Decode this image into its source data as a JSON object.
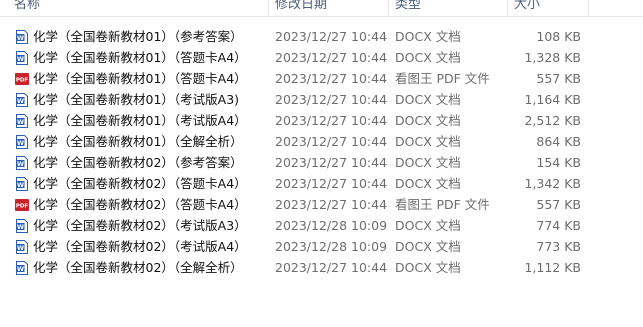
{
  "headers": {
    "name": "名称",
    "date": "修改日期",
    "type": "类型",
    "size": "大小"
  },
  "icons": {
    "docx": "word-doc-icon",
    "pdf": "pdf-doc-icon"
  },
  "colors": {
    "word_blue": "#2b5fb4",
    "pdf_red": "#c8222a",
    "header_text": "#4c607a"
  },
  "files": [
    {
      "name": "化学（全国卷新教材01）（参考答案）",
      "date": "2023/12/27 10:44",
      "type": "DOCX 文档",
      "size": "108 KB",
      "icon": "docx"
    },
    {
      "name": "化学（全国卷新教材01）（答题卡A4）",
      "date": "2023/12/27 10:44",
      "type": "DOCX 文档",
      "size": "1,328 KB",
      "icon": "docx"
    },
    {
      "name": "化学（全国卷新教材01）（答题卡A4）",
      "date": "2023/12/27 10:44",
      "type": "看图王 PDF 文件",
      "size": "557 KB",
      "icon": "pdf"
    },
    {
      "name": "化学（全国卷新教材01）（考试版A3)",
      "date": "2023/12/27 10:44",
      "type": "DOCX 文档",
      "size": "1,164 KB",
      "icon": "docx"
    },
    {
      "name": "化学（全国卷新教材01）（考试版A4）",
      "date": "2023/12/27 10:44",
      "type": "DOCX 文档",
      "size": "2,512 KB",
      "icon": "docx"
    },
    {
      "name": "化学（全国卷新教材01）（全解全析）",
      "date": "2023/12/27 10:44",
      "type": "DOCX 文档",
      "size": "864 KB",
      "icon": "docx"
    },
    {
      "name": "化学（全国卷新教材02）（参考答案）",
      "date": "2023/12/27 10:44",
      "type": "DOCX 文档",
      "size": "154 KB",
      "icon": "docx"
    },
    {
      "name": "化学（全国卷新教材02）（答题卡A4）",
      "date": "2023/12/27 10:44",
      "type": "DOCX 文档",
      "size": "1,342 KB",
      "icon": "docx"
    },
    {
      "name": "化学（全国卷新教材02）（答题卡A4）",
      "date": "2023/12/27 10:44",
      "type": "看图王 PDF 文件",
      "size": "557 KB",
      "icon": "pdf"
    },
    {
      "name": "化学（全国卷新教材02）（考试版A3）",
      "date": "2023/12/28 10:09",
      "type": "DOCX 文档",
      "size": "774 KB",
      "icon": "docx"
    },
    {
      "name": "化学（全国卷新教材02）（考试版A4）",
      "date": "2023/12/28 10:09",
      "type": "DOCX 文档",
      "size": "773 KB",
      "icon": "docx"
    },
    {
      "name": "化学（全国卷新教材02）（全解全析）",
      "date": "2023/12/27 10:44",
      "type": "DOCX 文档",
      "size": "1,112 KB",
      "icon": "docx"
    }
  ]
}
